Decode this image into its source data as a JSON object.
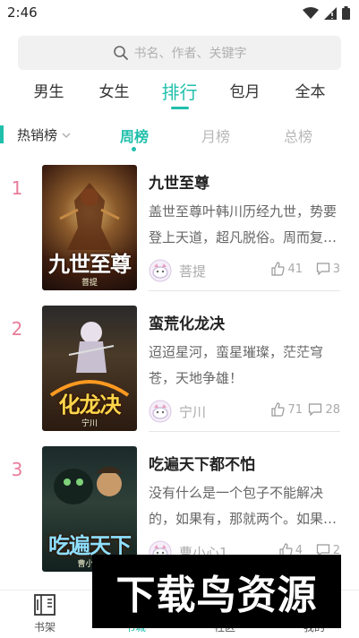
{
  "status": {
    "time": "2:46"
  },
  "search": {
    "placeholder": "书名、作者、关键字"
  },
  "top_tabs": [
    {
      "label": "男生"
    },
    {
      "label": "女生"
    },
    {
      "label": "排行"
    },
    {
      "label": "包月"
    },
    {
      "label": "全本"
    }
  ],
  "active_top_tab": "排行",
  "filter": {
    "label": "热销榜"
  },
  "period_tabs": [
    {
      "label": "周榜"
    },
    {
      "label": "月榜"
    },
    {
      "label": "总榜"
    }
  ],
  "active_period_tab": "周榜",
  "books": [
    {
      "rank": "1",
      "title": "九世至尊",
      "desc": "盖世至尊叶韩川历经九世，势要登上天道，超凡脱俗。周而复始，万古不朽……",
      "author": "菩提",
      "likes": "41",
      "comments": "3",
      "cover_title": "九世至尊",
      "cover_author": "菩提"
    },
    {
      "rank": "2",
      "title": "蛮荒化龙决",
      "desc": "迢迢星河，蛮星璀璨，茫茫穹苍，天地争雄！",
      "author": "宁川",
      "likes": "71",
      "comments": "28",
      "cover_title": "化龙决",
      "cover_author": "宁川"
    },
    {
      "rank": "3",
      "title": "吃遍天下都不怕",
      "desc": "没有什么是一个包子不能解决的，如果有，那就两个。如果还不行……",
      "author": "曹小心1",
      "likes": "4",
      "comments": "2",
      "cover_title": "吃遍天下",
      "cover_author": "曹小心"
    }
  ],
  "bottom_nav": [
    {
      "label": "书架",
      "icon": "bookshelf-icon"
    },
    {
      "label": "书城",
      "icon": "bookstore-icon"
    },
    {
      "label": "社区",
      "icon": "community-icon"
    },
    {
      "label": "我的",
      "icon": "profile-icon"
    }
  ],
  "watermark": {
    "text": "下载鸟资源"
  },
  "colors": {
    "accent": "#1fbfab",
    "rank": "#e87c9a"
  }
}
